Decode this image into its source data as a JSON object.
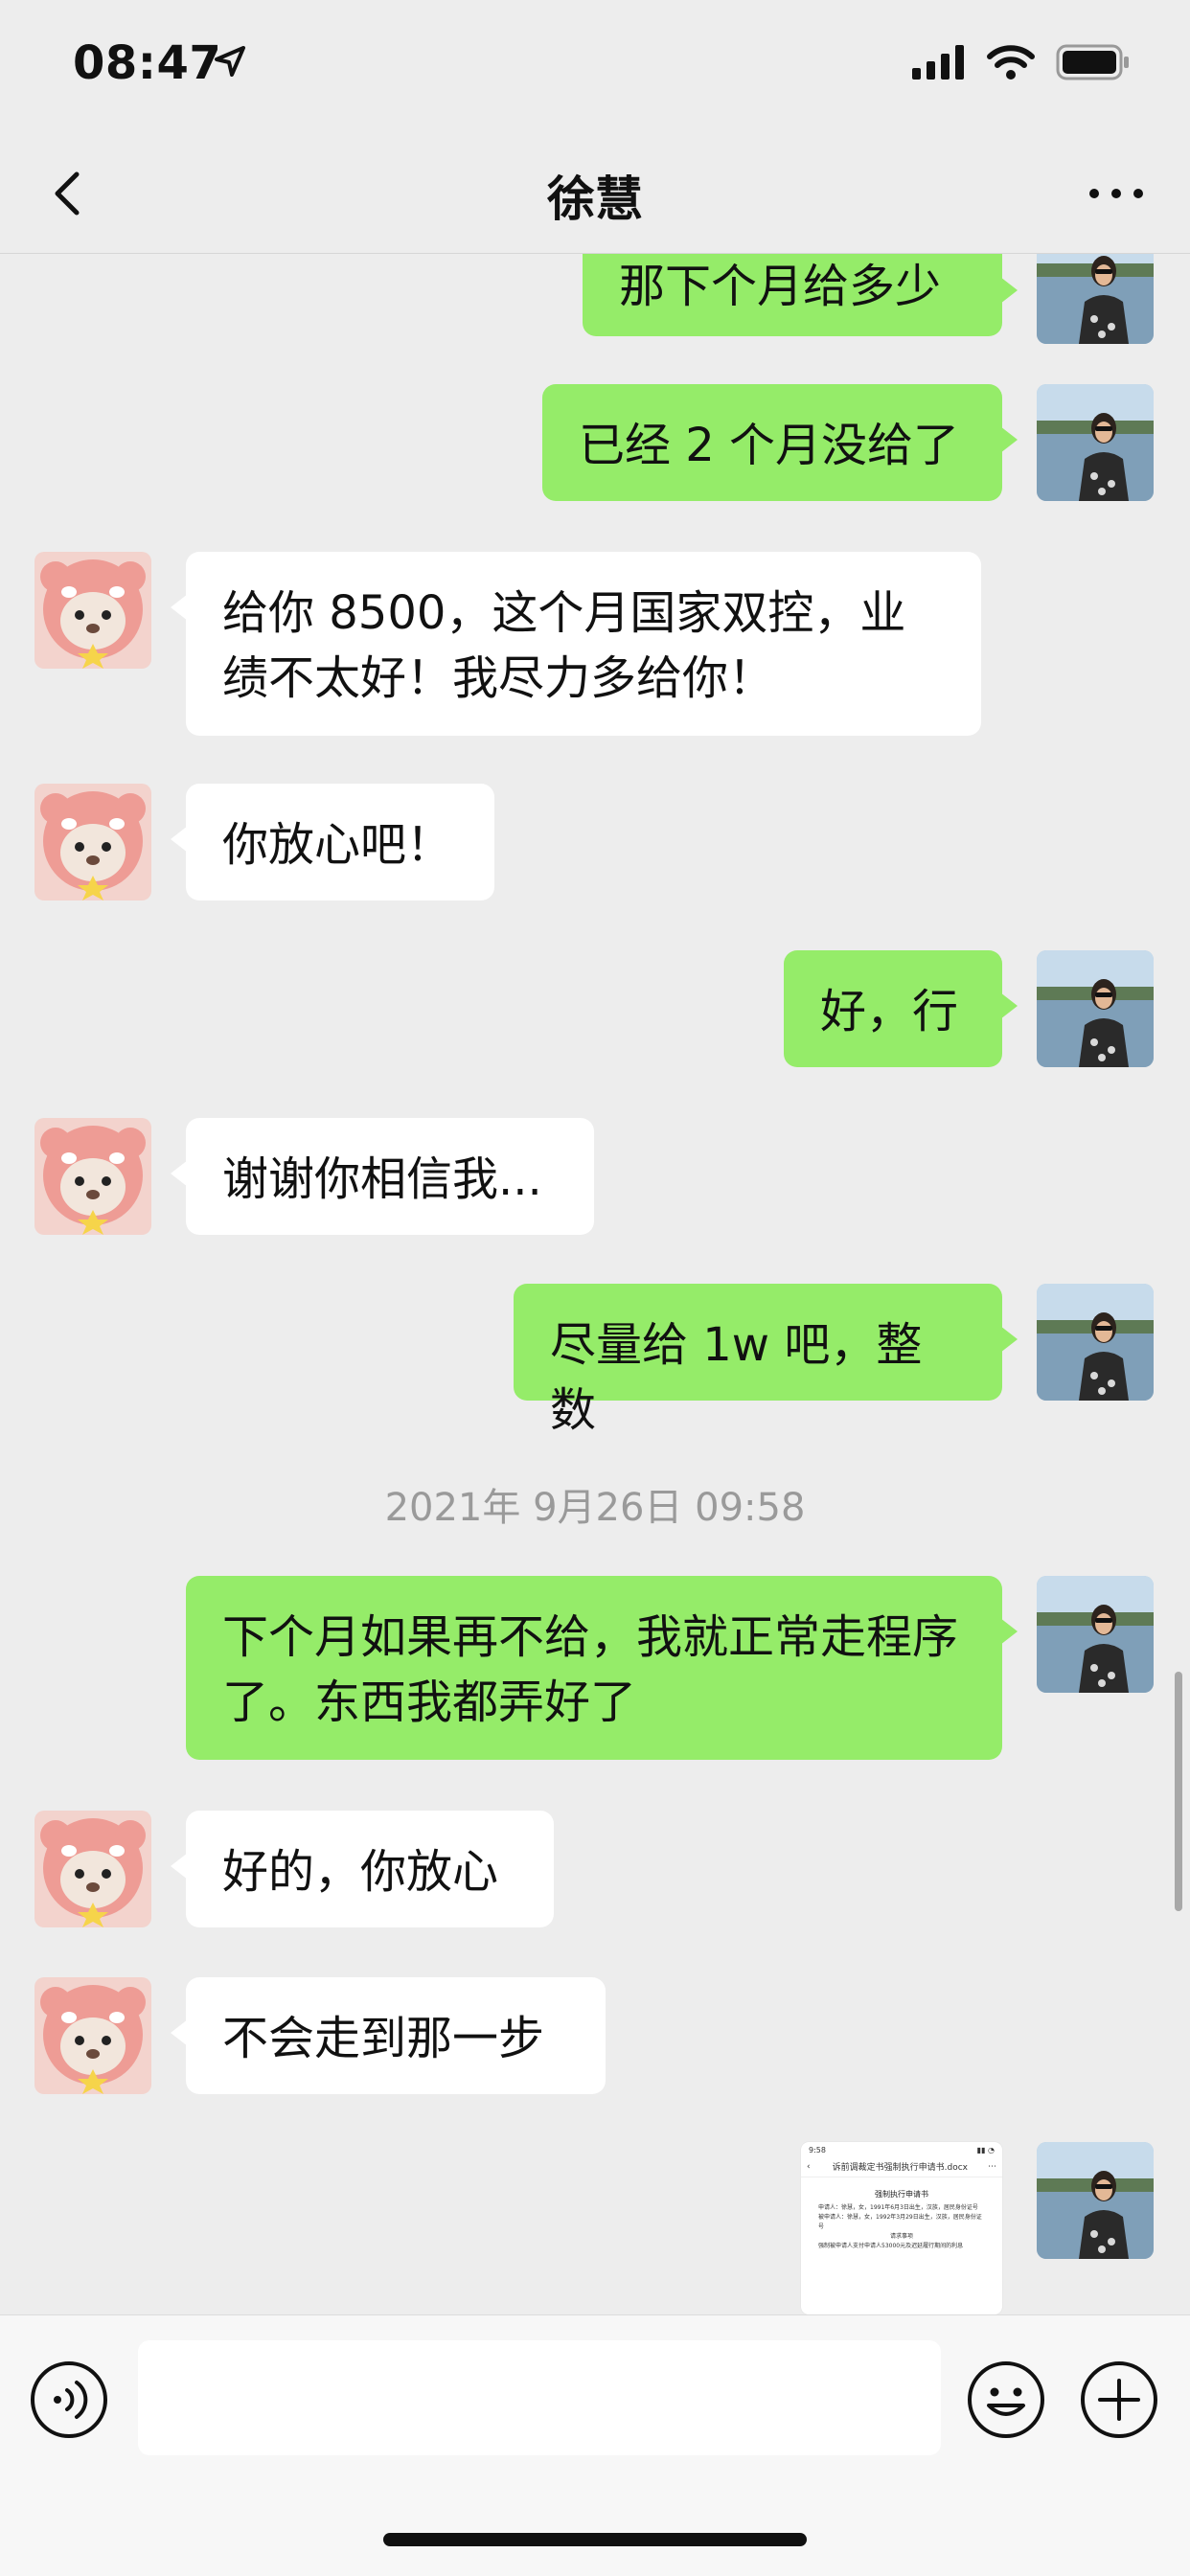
{
  "status_bar": {
    "time": "08:47"
  },
  "header": {
    "title": "徐慧"
  },
  "messages": [
    {
      "side": "out",
      "text": "那下个月给多少"
    },
    {
      "side": "out",
      "text": "已经 2 个月没给了"
    },
    {
      "side": "in",
      "text": "给你 8500，这个月国家双控，业绩不太好！我尽力多给你！"
    },
    {
      "side": "in",
      "text": "你放心吧！"
    },
    {
      "side": "out",
      "text": "好，行"
    },
    {
      "side": "in",
      "text": "谢谢你相信我..."
    },
    {
      "side": "out",
      "text": "尽量给 1w 吧，整数"
    },
    {
      "side": "time",
      "text": "2021年 9月26日 09:58"
    },
    {
      "side": "out",
      "text": "下个月如果再不给，我就正常走程序了。东西我都弄好了"
    },
    {
      "side": "in",
      "text": "好的，你放心"
    },
    {
      "side": "in",
      "text": "不会走到那一步"
    }
  ],
  "doc_preview": {
    "status_time": "9:58",
    "title": "诉前调裁定书强制执行申请书.docx",
    "heading": "强制执行申请书",
    "lines": [
      "申请人：徐慧，女，1991年6月3日出生，汉族，居民身份证号",
      "被申请人：徐慧，女，1992年3月29日出生，汉族，居民身份证号",
      "请求事项",
      "强制被申请人支付申请人53000元及迟延履行期间的利息"
    ]
  },
  "input_bar": {
    "placeholder": ""
  },
  "colors": {
    "outgoing": "#95ec69",
    "incoming": "#ffffff",
    "background": "#ededed"
  },
  "icons": [
    "signal-icon",
    "wifi-icon",
    "battery-icon",
    "location-arrow-icon",
    "back-icon",
    "more-icon",
    "voice-icon",
    "emoji-icon",
    "plus-icon"
  ]
}
